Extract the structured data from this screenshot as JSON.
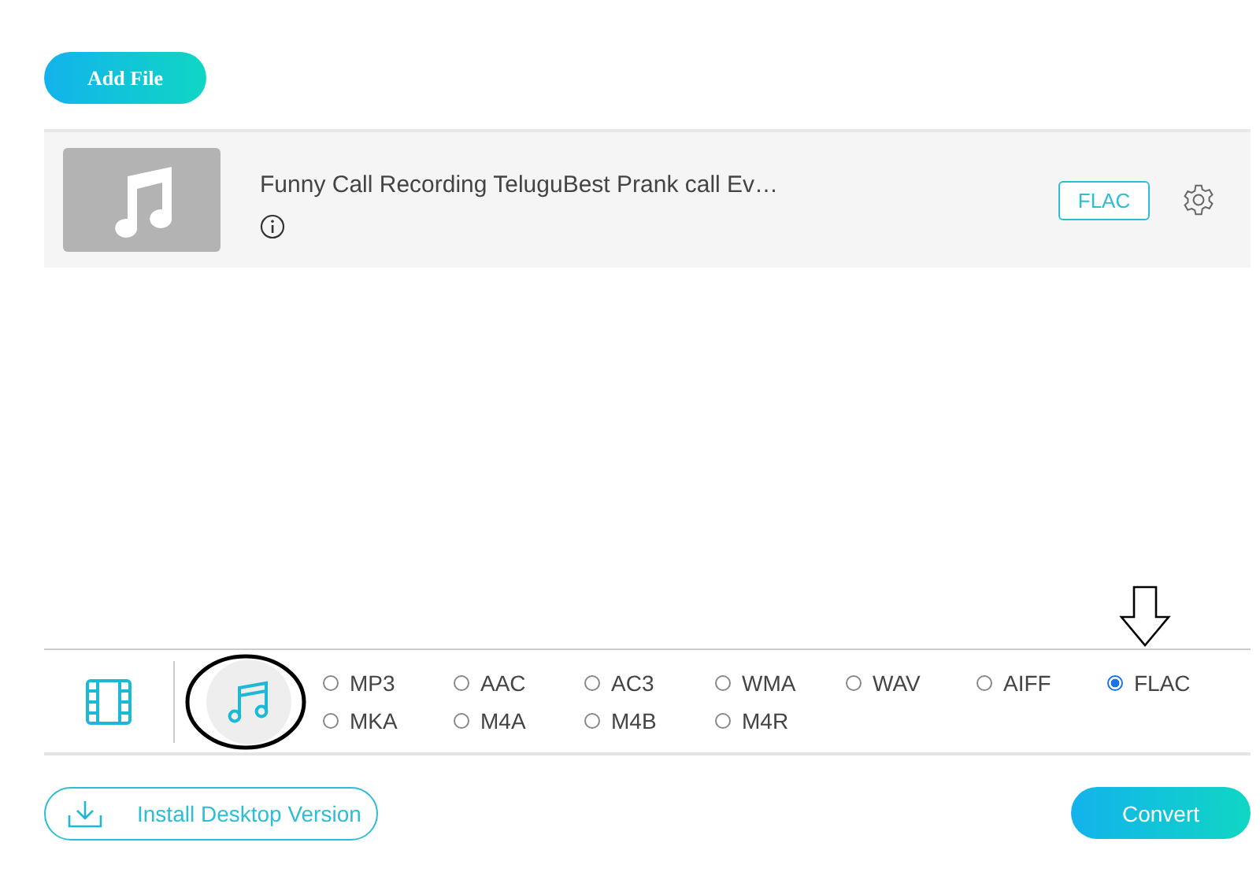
{
  "add_file_button": "Add File",
  "files": [
    {
      "title": "Funny Call Recording TeluguBest Prank call Ev…",
      "format": "FLAC"
    }
  ],
  "tabs": [
    {
      "kind": "video",
      "selected": false
    },
    {
      "kind": "audio",
      "selected": true
    }
  ],
  "formats": [
    {
      "label": "MP3",
      "selected": false
    },
    {
      "label": "AAC",
      "selected": false
    },
    {
      "label": "AC3",
      "selected": false
    },
    {
      "label": "WMA",
      "selected": false
    },
    {
      "label": "WAV",
      "selected": false
    },
    {
      "label": "AIFF",
      "selected": false
    },
    {
      "label": "FLAC",
      "selected": true
    },
    {
      "label": "MKA",
      "selected": false
    },
    {
      "label": "M4A",
      "selected": false
    },
    {
      "label": "M4B",
      "selected": false
    },
    {
      "label": "M4R",
      "selected": false
    }
  ],
  "install_button": "Install Desktop Version",
  "convert_button": "Convert"
}
